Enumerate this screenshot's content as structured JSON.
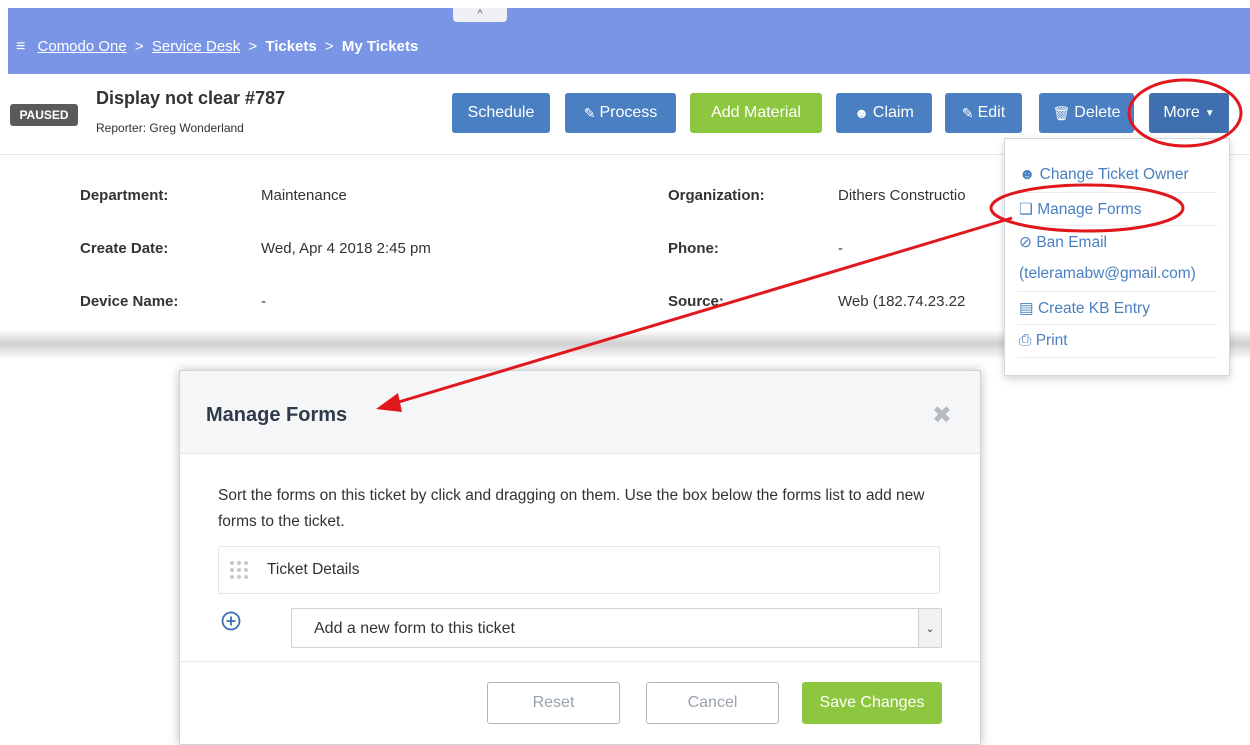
{
  "breadcrumb": {
    "items": [
      {
        "label": "Comodo One",
        "link": true
      },
      {
        "label": "Service Desk",
        "link": true
      },
      {
        "label": "Tickets",
        "link": false
      },
      {
        "label": "My Tickets",
        "link": false
      }
    ],
    "separator": ">",
    "collapse_glyph": "^"
  },
  "ticket": {
    "status_badge": "PAUSED",
    "title": "Display not clear #787",
    "reporter": "Reporter: Greg Wonderland"
  },
  "toolbar": {
    "schedule": "Schedule",
    "process": "Process",
    "add_material": "Add Material",
    "claim": "Claim",
    "edit": "Edit",
    "delete": "Delete",
    "more": "More"
  },
  "details": {
    "department_label": "Department:",
    "department_value": "Maintenance",
    "create_date_label": "Create Date:",
    "create_date_value": "Wed, Apr 4 2018 2:45 pm",
    "device_name_label": "Device Name:",
    "device_name_value": "-",
    "organization_label": "Organization:",
    "organization_value": "Dithers Constructio",
    "phone_label": "Phone:",
    "phone_value": "-",
    "source_label": "Source:",
    "source_value": "Web  (182.74.23.22"
  },
  "more_menu": {
    "items": [
      {
        "label": "Change Ticket Owner",
        "icon": "user-circle-icon"
      },
      {
        "label": "Manage Forms",
        "icon": "copy-icon"
      },
      {
        "label": "Ban Email",
        "icon": "ban-icon"
      },
      {
        "label": "(teleramabw@gmail.com)",
        "icon": ""
      },
      {
        "label": "Create KB Entry",
        "icon": "file-text-icon"
      },
      {
        "label": "Print",
        "icon": "print-icon"
      }
    ]
  },
  "modal": {
    "title": "Manage Forms",
    "instructions": "Sort the forms on this ticket by click and dragging on them. Use the box below the forms list to add new forms to the ticket.",
    "forms": [
      "Ticket Details"
    ],
    "add_select_value": "Add a new form to this ticket",
    "reset": "Reset",
    "cancel": "Cancel",
    "save": "Save Changes"
  },
  "colors": {
    "topbar": "#7b95e6",
    "primary_button": "#4a7fc1",
    "success_button": "#8dc63f",
    "annotation": "#e0181e"
  }
}
